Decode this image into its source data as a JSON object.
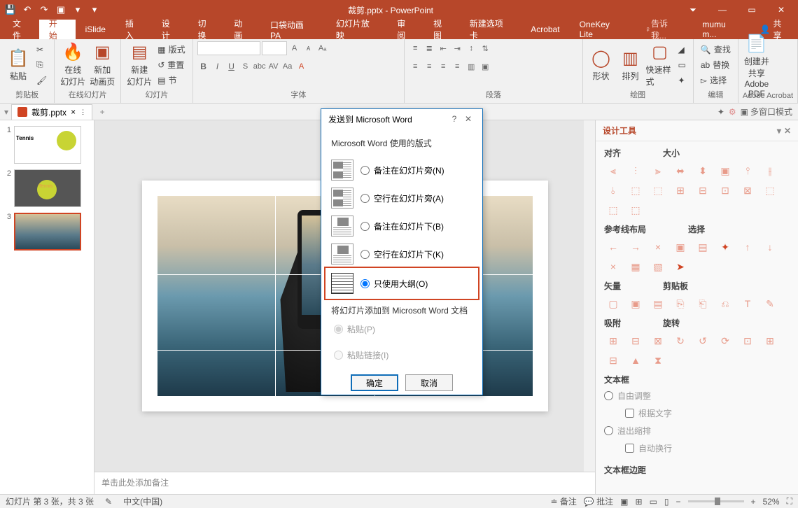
{
  "title": "裁剪.pptx - PowerPoint",
  "tabs": {
    "file": "文件",
    "home": "开始",
    "islide": "iSlide",
    "insert": "插入",
    "design": "设计",
    "transitions": "切换",
    "animations": "动画",
    "pa": "口袋动画 PA",
    "slideshow": "幻灯片放映",
    "review": "审阅",
    "view": "视图",
    "newtab": "新建选项卡",
    "acrobat": "Acrobat",
    "onekey": "OneKey Lite",
    "tell": "告诉我...",
    "user": "mumu m...",
    "share": "共享"
  },
  "ribbon": {
    "clipboard": "剪贴板",
    "paste": "粘贴",
    "online": "在线幻灯片",
    "online_btn": "在线\n幻灯片",
    "anim_btn": "新加\n动画页",
    "online_group": "在线幻灯片",
    "slides": "幻灯片",
    "newslide": "新建\n幻灯片",
    "layout": "版式",
    "reset": "重置",
    "section": "节",
    "font": "字体",
    "para": "段落",
    "drawing": "绘图",
    "shapes": "形状",
    "arrange": "排列",
    "quickstyles": "快速样式",
    "editing": "编辑",
    "find": "查找",
    "replace": "替换",
    "select": "选择",
    "adobe": "Adobe Acrobat",
    "createpdf": "创建并共享\nAdobe PDF"
  },
  "doctab": "裁剪.pptx",
  "extratabs": {
    "multiwin": "多窗口模式"
  },
  "thumbs": {
    "s1": "Tennis",
    "s2": "Tennis"
  },
  "notes": "单击此处添加备注",
  "design_panel": {
    "title": "设计工具",
    "align": "对齐",
    "size": "大小",
    "guides": "参考线布局",
    "select": "选择",
    "vector": "矢量",
    "clipboard": "剪贴板",
    "snap": "吸附",
    "rotate": "旋转",
    "textbox": "文本框",
    "auto": "自由调整",
    "bytext": "根据文字",
    "overflow": "溢出缩排",
    "autowrap": "自动换行",
    "margin": "文本框边距"
  },
  "dialog": {
    "title": "发送到 Microsoft Word",
    "section1": "Microsoft Word 使用的版式",
    "opt1": "备注在幻灯片旁(N)",
    "opt2": "空行在幻灯片旁(A)",
    "opt3": "备注在幻灯片下(B)",
    "opt4": "空行在幻灯片下(K)",
    "opt5": "只使用大纲(O)",
    "section2": "将幻灯片添加到 Microsoft Word 文档",
    "paste": "粘贴(P)",
    "pastelink": "粘贴链接(I)",
    "ok": "确定",
    "cancel": "取消"
  },
  "status": {
    "slide": "幻灯片 第 3 张，共 3 张",
    "lang": "中文(中国)",
    "notes": "备注",
    "comments": "批注",
    "zoom": "52%"
  }
}
